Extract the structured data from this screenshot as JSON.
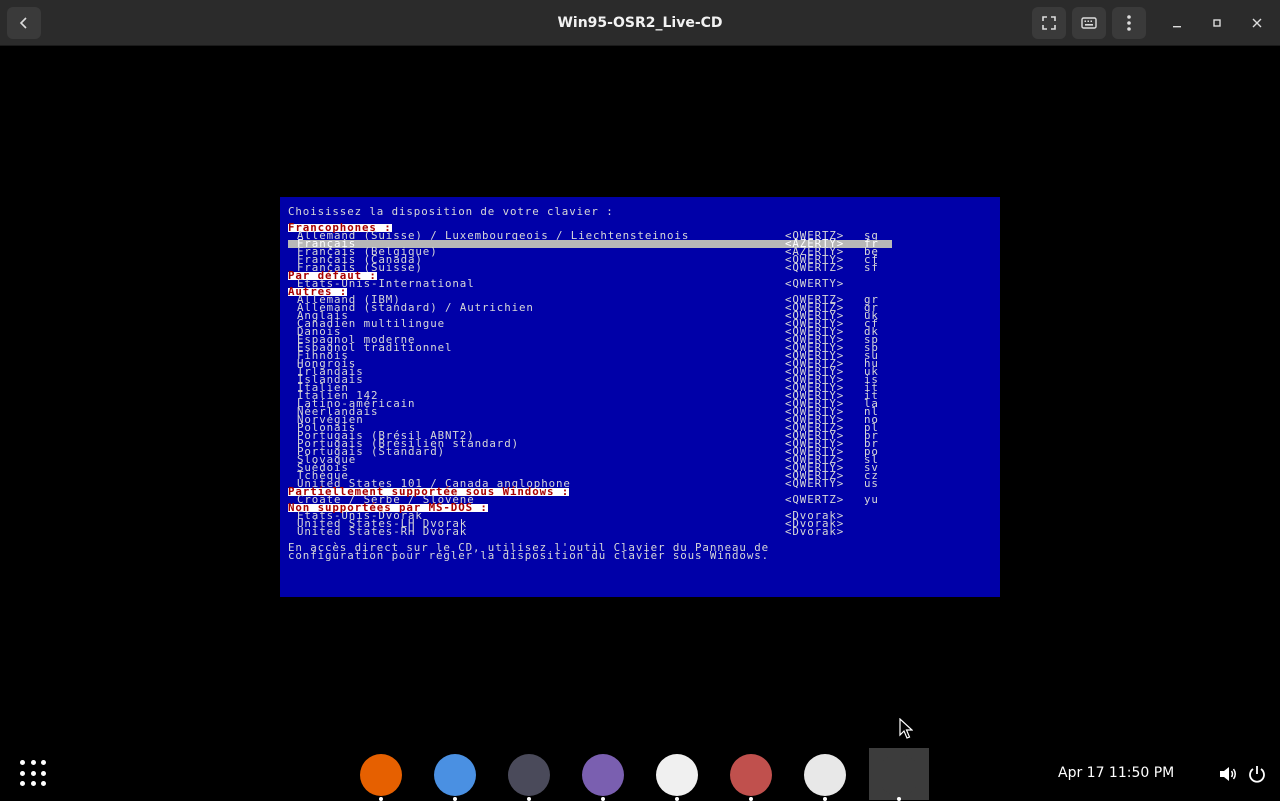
{
  "window": {
    "title": "Win95-OSR2_Live-CD"
  },
  "dos_screen": {
    "prompt": "Choisissez la disposition de votre clavier :",
    "groups": [
      {
        "header": "Francophones :",
        "rows": [
          {
            "name": "Allemand (Suisse) / Luxembourgeois / Liechtensteinois",
            "layout": "<QWERTZ>",
            "code": "sg"
          },
          {
            "name": "Français",
            "layout": "<AZERTY>",
            "code": "fr",
            "selected": true
          },
          {
            "name": "Français (Belgique)",
            "layout": "<AZERTY>",
            "code": "be"
          },
          {
            "name": "Français (Canada)",
            "layout": "<QWERTY>",
            "code": "cf"
          },
          {
            "name": "Français (Suisse)",
            "layout": "<QWERTZ>",
            "code": "sf"
          }
        ]
      },
      {
        "header": "Par défaut :",
        "rows": [
          {
            "name": "Etats-Unis-International",
            "layout": "<QWERTY>",
            "code": ""
          }
        ]
      },
      {
        "header": "Autres :",
        "rows": [
          {
            "name": "Allemand (IBM)",
            "layout": "<QWERTZ>",
            "code": "gr"
          },
          {
            "name": "Allemand (standard) / Autrichien",
            "layout": "<QWERTZ>",
            "code": "gr"
          },
          {
            "name": "Anglais",
            "layout": "<QWERTY>",
            "code": "uk"
          },
          {
            "name": "Canadien multilingue",
            "layout": "<QWERTY>",
            "code": "cf"
          },
          {
            "name": "Danois",
            "layout": "<QWERTY>",
            "code": "dk"
          },
          {
            "name": "Espagnol moderne",
            "layout": "<QWERTY>",
            "code": "sp"
          },
          {
            "name": "Espagnol traditionnel",
            "layout": "<QWERTY>",
            "code": "sp"
          },
          {
            "name": "Finnois",
            "layout": "<QWERTY>",
            "code": "su"
          },
          {
            "name": "Hongrois",
            "layout": "<QWERTZ>",
            "code": "hu"
          },
          {
            "name": "Irlandais",
            "layout": "<QWERTY>",
            "code": "uk"
          },
          {
            "name": "Islandais",
            "layout": "<QWERTY>",
            "code": "is"
          },
          {
            "name": "Italien",
            "layout": "<QWERTY>",
            "code": "it"
          },
          {
            "name": "Italien 142",
            "layout": "<QWERTY>",
            "code": "it"
          },
          {
            "name": "Latino-américain",
            "layout": "<QWERTY>",
            "code": "la"
          },
          {
            "name": "Néerlandais",
            "layout": "<QWERTY>",
            "code": "nl"
          },
          {
            "name": "Norvégien",
            "layout": "<QWERTY>",
            "code": "no"
          },
          {
            "name": "Polonais",
            "layout": "<QWERTZ>",
            "code": "pl"
          },
          {
            "name": "Portugais (Brésil ABNT2)",
            "layout": "<QWERTY>",
            "code": "br"
          },
          {
            "name": "Portugais (Brésilien standard)",
            "layout": "<QWERTY>",
            "code": "br"
          },
          {
            "name": "Portugais (Standard)",
            "layout": "<QWERTY>",
            "code": "po"
          },
          {
            "name": "Slovaque",
            "layout": "<QWERTZ>",
            "code": "sl"
          },
          {
            "name": "Suédois",
            "layout": "<QWERTY>",
            "code": "sv"
          },
          {
            "name": "Tchèque",
            "layout": "<QWERTZ>",
            "code": "cz"
          },
          {
            "name": "United States 101 / Canada anglophone",
            "layout": "<QWERTY>",
            "code": "us"
          }
        ]
      },
      {
        "header": "Partiellement supportée sous Windows :",
        "rows": [
          {
            "name": "Croate / Serbe / Slovène",
            "layout": "<QWERTZ>",
            "code": "yu"
          }
        ]
      },
      {
        "header": "Non supportées par MS-DOS :",
        "rows": [
          {
            "name": "Etats-Unis-Dvorak",
            "layout": "<Dvorak>",
            "code": ""
          },
          {
            "name": "United States-LH Dvorak",
            "layout": "<Dvorak>",
            "code": ""
          },
          {
            "name": "United States-RH Dvorak",
            "layout": "<Dvorak>",
            "code": ""
          }
        ]
      }
    ],
    "footer_line1": "En accès direct sur le CD, utilisez l'outil Clavier du Panneau de",
    "footer_line2": "configuration pour régler la disposition du clavier sous Windows."
  },
  "dock": {
    "apps": [
      {
        "name": "firefox-icon",
        "color": "#e66000"
      },
      {
        "name": "chromium-icon",
        "color": "#4a90e2"
      },
      {
        "name": "terminal-icon",
        "color": "#4a4a5a"
      },
      {
        "name": "files-icon",
        "color": "#7a5fb0"
      },
      {
        "name": "vm-icon",
        "color": "#f0f0f0"
      },
      {
        "name": "text-editor-icon",
        "color": "#c0504d"
      },
      {
        "name": "settings-toggle-icon",
        "color": "#e8e8e8"
      },
      {
        "name": "emulator-icon",
        "color": "#3c3c3c"
      }
    ],
    "clock": "Apr 17  11:50 PM"
  }
}
